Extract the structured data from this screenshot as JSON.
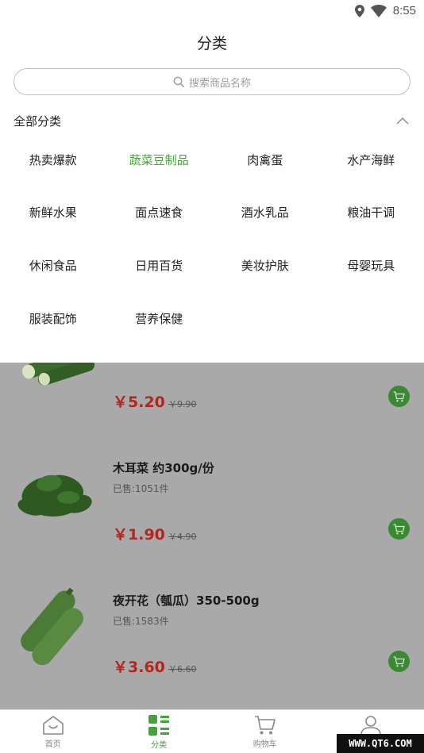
{
  "status_bar": {
    "time": "8:55"
  },
  "header": {
    "title": "分类"
  },
  "search": {
    "placeholder": "搜索商品名称"
  },
  "categories": {
    "title": "全部分类",
    "items": [
      {
        "label": "热卖爆款"
      },
      {
        "label": "蔬菜豆制品",
        "active": true
      },
      {
        "label": "肉禽蛋"
      },
      {
        "label": "水产海鲜"
      },
      {
        "label": "新鲜水果"
      },
      {
        "label": "面点速食"
      },
      {
        "label": "酒水乳品"
      },
      {
        "label": "粮油干调"
      },
      {
        "label": "休闲食品"
      },
      {
        "label": "日用百货"
      },
      {
        "label": "美妆护肤"
      },
      {
        "label": "母婴玩具"
      },
      {
        "label": "服装配饰"
      },
      {
        "label": "营养保健"
      }
    ]
  },
  "products": [
    {
      "name": "",
      "sold": "",
      "price": "￥5.20",
      "old_price": "￥9.90"
    },
    {
      "name": "木耳菜 约300g/份",
      "sold": "已售:1051件",
      "price": "￥1.90",
      "old_price": "￥4.90"
    },
    {
      "name": "夜开花（瓠瓜）350-500g",
      "sold": "已售:1583件",
      "price": "￥3.60",
      "old_price": "￥6.60"
    }
  ],
  "bottom_nav": [
    {
      "label": "首页",
      "icon": "home-icon"
    },
    {
      "label": "分类",
      "icon": "category-icon",
      "active": true
    },
    {
      "label": "购物车",
      "icon": "cart-icon"
    },
    {
      "label": "我的",
      "icon": "user-icon"
    }
  ],
  "watermark": "WWW.QT6.COM",
  "colors": {
    "accent": "#43a43a",
    "price": "#b3261e",
    "overlay": "#a9a9a9"
  }
}
